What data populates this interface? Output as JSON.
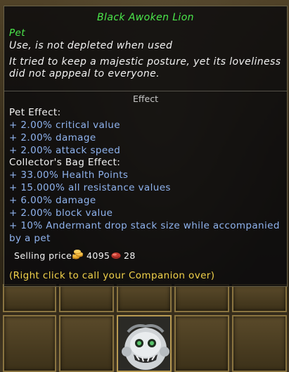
{
  "tooltip": {
    "title": "Black Awoken Lion",
    "category": "Pet",
    "usage": "Use, is not depleted when used",
    "description_line1": "It tried to keep a majestic posture, yet its loveliness",
    "description_line2": "did not apppeal to everyone.",
    "effect_header": "Effect",
    "pet_effect_header": "Pet Effect:",
    "pet_effects": [
      "+ 2.00%  critical  value",
      "+ 2.00%  damage",
      "+ 2.00%  attack  speed"
    ],
    "bag_effect_header": "Collector's  Bag  Effect:",
    "bag_effects": [
      "+ 33.00%  Health  Points",
      "+ 15.000%  all  resistance  values",
      "+ 6.00%  damage",
      "+ 2.00%  block  value",
      "+ 10%  Andermant  drop  stack  size  while  accompanied",
      "by  a  pet"
    ],
    "selling_price_label": "Selling  price:",
    "gold_amount": "4095",
    "ruby_amount": "28",
    "hint": "(Right  click  to  call  your  Companion  over)"
  },
  "colors": {
    "title_green": "#4be84b",
    "effect_blue": "#8fb3ee",
    "hint_yellow": "#f2d24a"
  },
  "icons": {
    "gold": "gold-coins-icon",
    "ruby": "ruby-icon",
    "item": "black-lion-pet-icon"
  }
}
